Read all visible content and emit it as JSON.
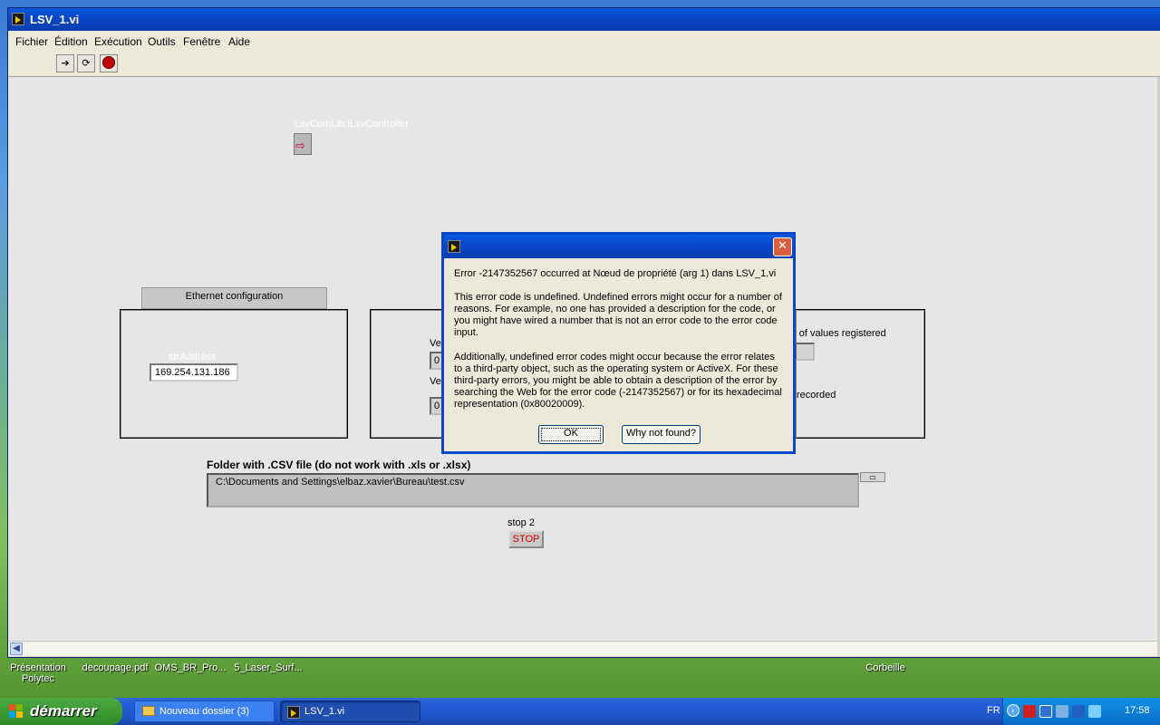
{
  "window": {
    "title": "LSV_1.vi",
    "menu": [
      "Fichier",
      "Édition",
      "Exécution",
      "Outils",
      "Fenêtre",
      "Aide"
    ]
  },
  "panel": {
    "property_node_label": "LsvComLib.ILsvController",
    "ethernet_tab": "Ethernet configuration",
    "str_address_label": "strAddress",
    "str_address_value": "169.254.131.186",
    "vel_label_1": "Vel",
    "vel_value_1": "0",
    "vel_label_2": "Vel",
    "vel_value_2": "0",
    "values_registered_label": "r of values registered",
    "recorded_label": "recorded",
    "folder_label": "Folder with .CSV file (do not work with .xls or .xlsx)",
    "path_value": "C:\\Documents and Settings\\elbaz.xavier\\Bureau\\test.csv",
    "stop_label": "stop 2",
    "stop_button": "STOP"
  },
  "dialog": {
    "close_glyph": "✕",
    "line1": "Error -2147352567 occurred at Nœud de propriété (arg 1) dans LSV_1.vi",
    "para1": "This error code is undefined. Undefined errors might occur for a number of reasons. For example, no one has provided a description for the code, or you might have wired a number that is not an error code to the error code input.",
    "para2": "Additionally, undefined error codes might occur because the error relates to a third-party object, such as the operating system or ActiveX. For these third-party errors, you might be able to obtain a description of the error by searching the Web for the error code (-2147352567) or for its hexadecimal representation (0x80020009).",
    "ok_button": "OK",
    "why_button": "Why not found?"
  },
  "desktop": {
    "icons": [
      "Présentation Polytec",
      "decoupage.pdf",
      "OMS_BR_Pro...",
      "5_Laser_Surf...",
      "Corbeille"
    ]
  },
  "taskbar": {
    "start": "démarrer",
    "tasks": [
      "Nouveau dossier (3)",
      "LSV_1.vi"
    ],
    "lang": "FR",
    "clock": "17:58",
    "colors": {
      "start": "#3c9a33",
      "bar": "#245edb",
      "tray": "#0c7fd8"
    }
  }
}
